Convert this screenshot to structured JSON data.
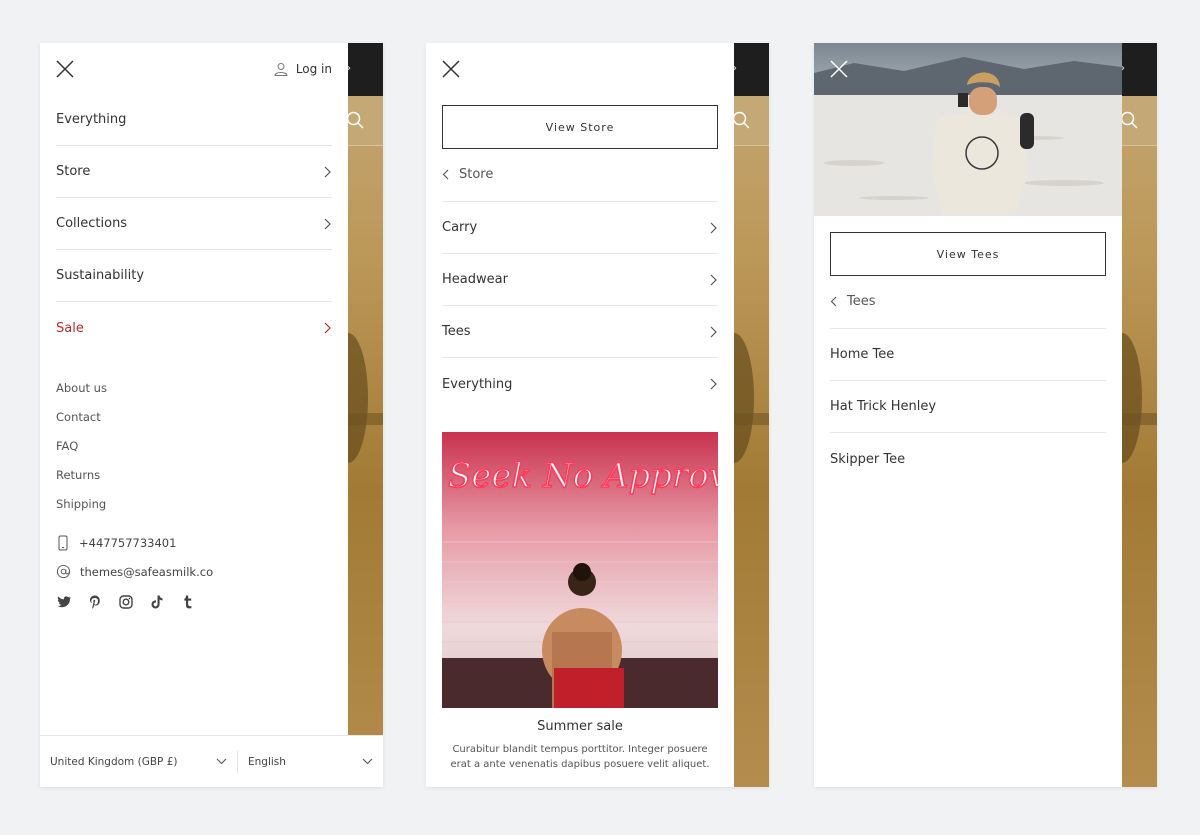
{
  "screen1": {
    "login_label": "Log in",
    "nav": [
      {
        "label": "Everything",
        "chevron": false
      },
      {
        "label": "Store",
        "chevron": true
      },
      {
        "label": "Collections",
        "chevron": true
      },
      {
        "label": "Sustainability",
        "chevron": false
      },
      {
        "label": "Sale",
        "chevron": true
      }
    ],
    "sale_color": "#b62a2a",
    "secondary_links": [
      "About us",
      "Contact",
      "FAQ",
      "Returns",
      "Shipping"
    ],
    "phone": "+447757733401",
    "email": "themes@safeasmilk.co",
    "social_icons": [
      "twitter-icon",
      "pinterest-icon",
      "instagram-icon",
      "tiktok-icon",
      "tumblr-icon"
    ],
    "country_selector": "United Kingdom (GBP £)",
    "language_selector": "English"
  },
  "screen2": {
    "view_button": "View Store",
    "back_label": "Store",
    "items": [
      "Carry",
      "Headwear",
      "Tees",
      "Everything"
    ],
    "neon_sign": "Seek No Approval",
    "promo_title": "Summer sale",
    "promo_text": "Curabitur blandit tempus porttitor. Integer posuere erat a ante venenatis dapibus posuere velit aliquet."
  },
  "screen3": {
    "view_button": "View Tees",
    "back_label": "Tees",
    "items": [
      "Home Tee",
      "Hat Trick Henley",
      "Skipper Tee"
    ]
  }
}
